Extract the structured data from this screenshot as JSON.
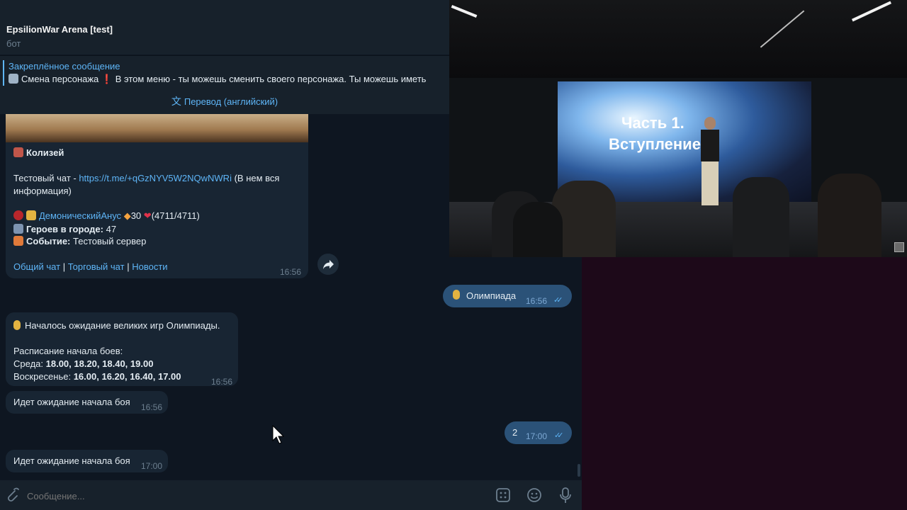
{
  "header": {
    "title": "EpsilionWar Arena [test]",
    "subtitle": "бот"
  },
  "pinned": {
    "title": "Закреплённое сообщение",
    "text": "Смена персонажа ❗ В этом меню - ты можешь сменить своего персонажа. Ты можешь иметь"
  },
  "translate": {
    "label": "Перевод (английский)"
  },
  "messages": {
    "coliseum": {
      "title": "Колизей",
      "chat_prefix": "Тестовый чат - ",
      "chat_link": "https://t.me/+qGzNYV5W2NQwNWRi",
      "chat_suffix": " (В нем вся информация)",
      "player_name": "ДемоническийАнус",
      "player_level": "30",
      "player_hp": "(4711/4711)",
      "heroes_label": "Героев в городе:",
      "heroes_value": "47",
      "event_label": "Событие:",
      "event_value": "Тестовый сервер",
      "link_general": "Общий чат",
      "link_trade": "Торговый чат",
      "link_news": "Новости",
      "separator": "|",
      "time": "16:56"
    },
    "out1": {
      "text": "Олимпиада",
      "time": "16:56"
    },
    "olympiad": {
      "line1": "Началось ожидание великих игр Олимпиады.",
      "line2": "Расписание начала боев:",
      "line3_label": "Среда:",
      "line3_value": "18.00, 18.20, 18.40, 19.00",
      "line4_label": "Воскресенье:",
      "line4_value": "16.00, 16.20, 16.40, 17.00",
      "time": "16:56"
    },
    "wait1": {
      "text": "Идет ожидание начала боя",
      "time": "16:56"
    },
    "out2": {
      "text": "2",
      "time": "17:00"
    },
    "wait2": {
      "text": "Идет ожидание начала боя",
      "time": "17:00"
    }
  },
  "input": {
    "placeholder": "Сообщение..."
  },
  "video": {
    "slide_line1": "Часть 1.",
    "slide_line2": "Вступление."
  },
  "icons": {
    "attach": "paperclip-icon",
    "commands": "bot-commands-icon",
    "emoji": "emoji-icon",
    "mic": "microphone-icon",
    "forward": "forward-icon",
    "translate": "translate-icon"
  },
  "colors": {
    "accent": "#5eb5f7",
    "bg": "#0e1621",
    "panel": "#17212b",
    "bubble_in": "#182533",
    "bubble_out": "#2b5278"
  }
}
